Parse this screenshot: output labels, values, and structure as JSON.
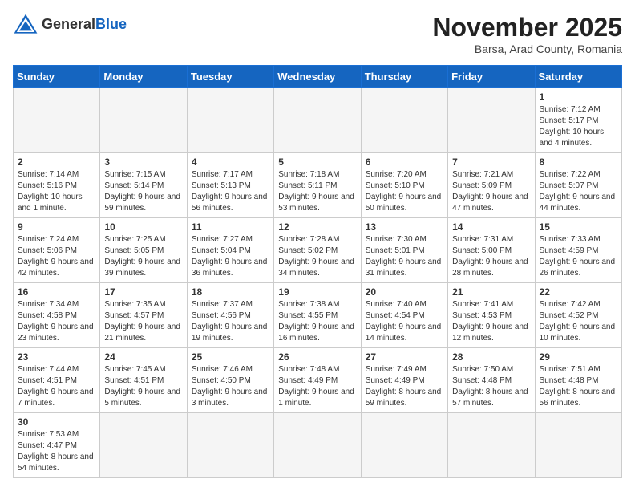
{
  "header": {
    "logo_general": "General",
    "logo_blue": "Blue",
    "month": "November 2025",
    "location": "Barsa, Arad County, Romania"
  },
  "weekdays": [
    "Sunday",
    "Monday",
    "Tuesday",
    "Wednesday",
    "Thursday",
    "Friday",
    "Saturday"
  ],
  "weeks": [
    [
      {
        "day": "",
        "info": ""
      },
      {
        "day": "",
        "info": ""
      },
      {
        "day": "",
        "info": ""
      },
      {
        "day": "",
        "info": ""
      },
      {
        "day": "",
        "info": ""
      },
      {
        "day": "",
        "info": ""
      },
      {
        "day": "1",
        "info": "Sunrise: 7:12 AM\nSunset: 5:17 PM\nDaylight: 10 hours and 4 minutes."
      }
    ],
    [
      {
        "day": "2",
        "info": "Sunrise: 7:14 AM\nSunset: 5:16 PM\nDaylight: 10 hours and 1 minute."
      },
      {
        "day": "3",
        "info": "Sunrise: 7:15 AM\nSunset: 5:14 PM\nDaylight: 9 hours and 59 minutes."
      },
      {
        "day": "4",
        "info": "Sunrise: 7:17 AM\nSunset: 5:13 PM\nDaylight: 9 hours and 56 minutes."
      },
      {
        "day": "5",
        "info": "Sunrise: 7:18 AM\nSunset: 5:11 PM\nDaylight: 9 hours and 53 minutes."
      },
      {
        "day": "6",
        "info": "Sunrise: 7:20 AM\nSunset: 5:10 PM\nDaylight: 9 hours and 50 minutes."
      },
      {
        "day": "7",
        "info": "Sunrise: 7:21 AM\nSunset: 5:09 PM\nDaylight: 9 hours and 47 minutes."
      },
      {
        "day": "8",
        "info": "Sunrise: 7:22 AM\nSunset: 5:07 PM\nDaylight: 9 hours and 44 minutes."
      }
    ],
    [
      {
        "day": "9",
        "info": "Sunrise: 7:24 AM\nSunset: 5:06 PM\nDaylight: 9 hours and 42 minutes."
      },
      {
        "day": "10",
        "info": "Sunrise: 7:25 AM\nSunset: 5:05 PM\nDaylight: 9 hours and 39 minutes."
      },
      {
        "day": "11",
        "info": "Sunrise: 7:27 AM\nSunset: 5:04 PM\nDaylight: 9 hours and 36 minutes."
      },
      {
        "day": "12",
        "info": "Sunrise: 7:28 AM\nSunset: 5:02 PM\nDaylight: 9 hours and 34 minutes."
      },
      {
        "day": "13",
        "info": "Sunrise: 7:30 AM\nSunset: 5:01 PM\nDaylight: 9 hours and 31 minutes."
      },
      {
        "day": "14",
        "info": "Sunrise: 7:31 AM\nSunset: 5:00 PM\nDaylight: 9 hours and 28 minutes."
      },
      {
        "day": "15",
        "info": "Sunrise: 7:33 AM\nSunset: 4:59 PM\nDaylight: 9 hours and 26 minutes."
      }
    ],
    [
      {
        "day": "16",
        "info": "Sunrise: 7:34 AM\nSunset: 4:58 PM\nDaylight: 9 hours and 23 minutes."
      },
      {
        "day": "17",
        "info": "Sunrise: 7:35 AM\nSunset: 4:57 PM\nDaylight: 9 hours and 21 minutes."
      },
      {
        "day": "18",
        "info": "Sunrise: 7:37 AM\nSunset: 4:56 PM\nDaylight: 9 hours and 19 minutes."
      },
      {
        "day": "19",
        "info": "Sunrise: 7:38 AM\nSunset: 4:55 PM\nDaylight: 9 hours and 16 minutes."
      },
      {
        "day": "20",
        "info": "Sunrise: 7:40 AM\nSunset: 4:54 PM\nDaylight: 9 hours and 14 minutes."
      },
      {
        "day": "21",
        "info": "Sunrise: 7:41 AM\nSunset: 4:53 PM\nDaylight: 9 hours and 12 minutes."
      },
      {
        "day": "22",
        "info": "Sunrise: 7:42 AM\nSunset: 4:52 PM\nDaylight: 9 hours and 10 minutes."
      }
    ],
    [
      {
        "day": "23",
        "info": "Sunrise: 7:44 AM\nSunset: 4:51 PM\nDaylight: 9 hours and 7 minutes."
      },
      {
        "day": "24",
        "info": "Sunrise: 7:45 AM\nSunset: 4:51 PM\nDaylight: 9 hours and 5 minutes."
      },
      {
        "day": "25",
        "info": "Sunrise: 7:46 AM\nSunset: 4:50 PM\nDaylight: 9 hours and 3 minutes."
      },
      {
        "day": "26",
        "info": "Sunrise: 7:48 AM\nSunset: 4:49 PM\nDaylight: 9 hours and 1 minute."
      },
      {
        "day": "27",
        "info": "Sunrise: 7:49 AM\nSunset: 4:49 PM\nDaylight: 8 hours and 59 minutes."
      },
      {
        "day": "28",
        "info": "Sunrise: 7:50 AM\nSunset: 4:48 PM\nDaylight: 8 hours and 57 minutes."
      },
      {
        "day": "29",
        "info": "Sunrise: 7:51 AM\nSunset: 4:48 PM\nDaylight: 8 hours and 56 minutes."
      }
    ],
    [
      {
        "day": "30",
        "info": "Sunrise: 7:53 AM\nSunset: 4:47 PM\nDaylight: 8 hours and 54 minutes."
      },
      {
        "day": "",
        "info": ""
      },
      {
        "day": "",
        "info": ""
      },
      {
        "day": "",
        "info": ""
      },
      {
        "day": "",
        "info": ""
      },
      {
        "day": "",
        "info": ""
      },
      {
        "day": "",
        "info": ""
      }
    ]
  ]
}
